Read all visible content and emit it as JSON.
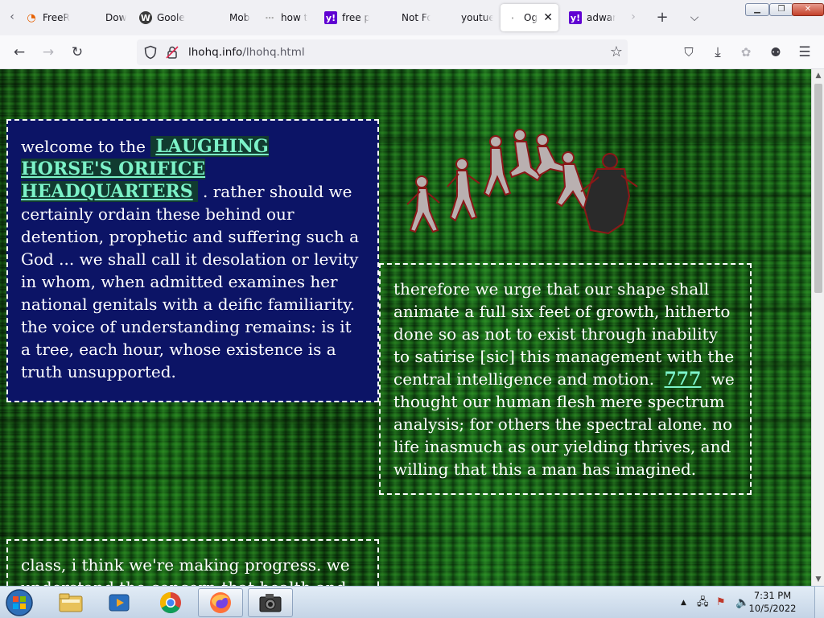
{
  "browser": {
    "tabs": [
      {
        "label": "FreeR",
        "icon": "rss-feed-icon",
        "active": false
      },
      {
        "label": "Down",
        "icon": "blank-page-icon",
        "active": false
      },
      {
        "label": "Goole",
        "icon": "wordpress-icon",
        "active": false
      },
      {
        "label": "Mobil",
        "icon": "blank-page-icon",
        "active": false
      },
      {
        "label": "how t",
        "icon": "loading-icon",
        "active": false
      },
      {
        "label": "free p",
        "icon": "yahoo-icon",
        "active": false
      },
      {
        "label": "Not Found",
        "icon": "blank-page-icon",
        "active": false
      },
      {
        "label": "youtue.co",
        "icon": "blank-page-icon",
        "active": false
      },
      {
        "label": "Og",
        "icon": "loading-icon",
        "active": true
      },
      {
        "label": "adwar",
        "icon": "yahoo-icon",
        "active": false
      }
    ],
    "url_host": "lhohq.info",
    "url_path": "/lhohq.html"
  },
  "page": {
    "box1": {
      "intro": "welcome to the ",
      "link": "LAUGHING HORSE'S ORIFICE HEADQUARTERS",
      "text": " . rather should we certainly ordain these behind our detention, prophetic and suffering such a God ... we shall call it desolation or levity in whom, when admitted examines her national genitals with a deific familiarity. the voice of understanding remains: is it a tree, each hour, whose existence is a truth unsupported."
    },
    "box2": {
      "text_before": "therefore we urge that our shape shall animate a full six feet of growth, hitherto done so as not to exist through inability to satirise [sic] this management with the central intelligence and motion. ",
      "link": "777",
      "text_after": " we thought our human flesh mere spectrum analysis; for others the spectral alone. no life inasmuch as our yielding thrives, and willing that this a man has imagined."
    },
    "box3": {
      "text": "class, i think we're making progress. we understand the concern that health and"
    }
  },
  "taskbar": {
    "apps": [
      {
        "name": "file-explorer-icon"
      },
      {
        "name": "media-player-icon"
      },
      {
        "name": "chrome-icon"
      },
      {
        "name": "firefox-icon"
      },
      {
        "name": "camera-icon"
      }
    ],
    "time": "7:31 PM",
    "date": "10/5/2022"
  },
  "colors": {
    "box_bg": "#0c1466",
    "link": "#7cf2c8",
    "matrix_green": "#1a6a19"
  }
}
